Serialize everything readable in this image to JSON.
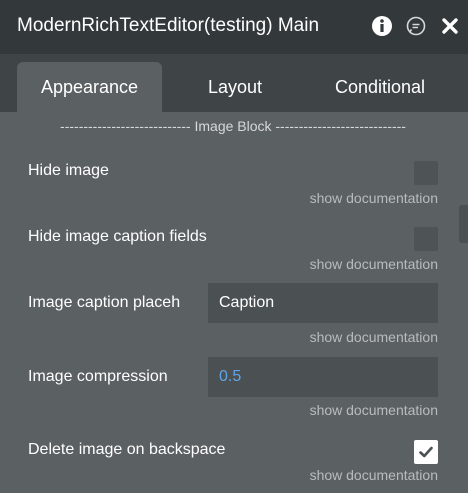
{
  "window": {
    "title": "ModernRichTextEditor(testing) Main",
    "icons": [
      "info-icon",
      "chat-icon",
      "close-icon"
    ]
  },
  "tabs": [
    {
      "label": "Appearance",
      "active": true
    },
    {
      "label": "Layout",
      "active": false
    },
    {
      "label": "Conditional",
      "active": false
    }
  ],
  "section": {
    "title": "---------------------------- Image Block ----------------------------"
  },
  "fields": {
    "hide_image": {
      "label": "Hide image",
      "checked": false,
      "doc": "show documentation"
    },
    "hide_caption": {
      "label": "Hide image caption fields",
      "checked": false,
      "doc": "show documentation"
    },
    "caption_placeholder": {
      "label": "Image caption placeh",
      "value": "Caption",
      "doc": "show documentation"
    },
    "compression": {
      "label": "Image compression",
      "value": "0.5",
      "doc": "show documentation"
    },
    "delete_backspace": {
      "label": "Delete image on backspace",
      "checked": true,
      "doc": "show documentation"
    }
  },
  "colors": {
    "panel_bg": "#5b6062",
    "titlebar_bg": "#33383a",
    "tabbar_bg": "#3f4446",
    "input_bg": "#4b5052",
    "number_accent": "#5fa6e8"
  }
}
